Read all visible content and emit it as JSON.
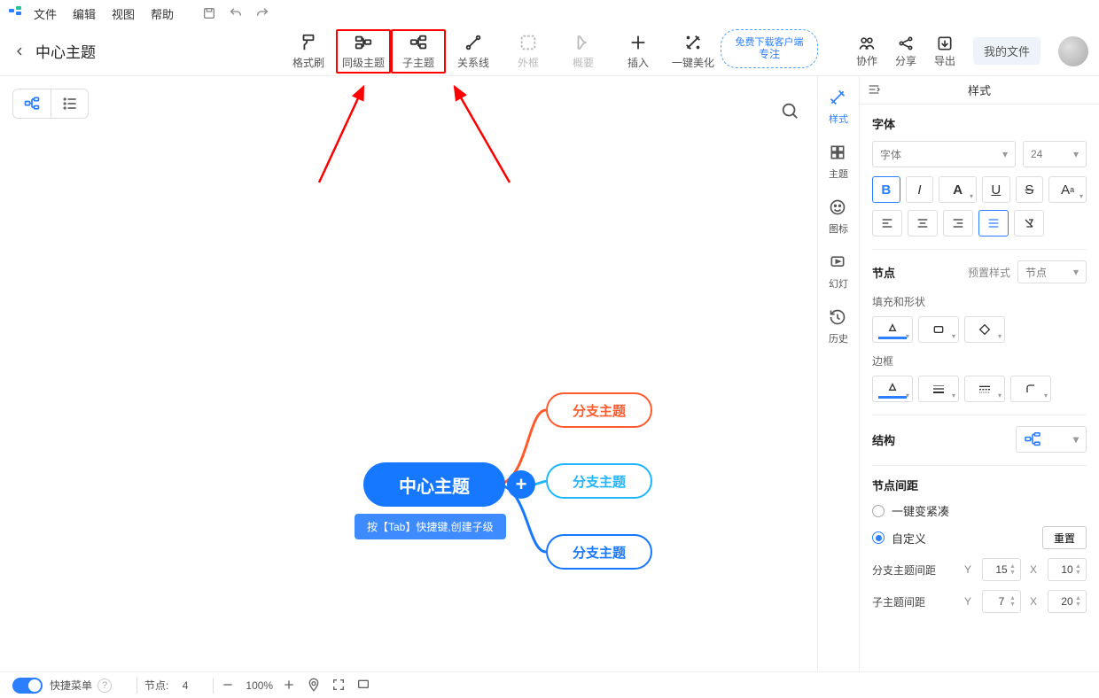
{
  "menubar": {
    "items": [
      "文件",
      "编辑",
      "视图",
      "帮助"
    ]
  },
  "header": {
    "title": "中心主题",
    "toolbar": {
      "format_painter": "格式刷",
      "same_level": "同级主题",
      "child_topic": "子主题",
      "relation": "关系线",
      "frame": "外框",
      "summary": "概要",
      "insert": "插入",
      "beautify": "一键美化",
      "promo_top": "免费下载客户端",
      "focus": "专注",
      "collab": "协作",
      "share": "分享",
      "export": "导出"
    },
    "my_files": "我的文件"
  },
  "sidenav": {
    "style": "样式",
    "theme": "主题",
    "icon": "图标",
    "slide": "幻灯",
    "history": "历史"
  },
  "panel": {
    "title": "样式",
    "font_section": "字体",
    "font_placeholder": "字体",
    "font_size": "24",
    "node_section": "节点",
    "preset": "预置样式",
    "preset_value": "节点",
    "fill_shape": "填充和形状",
    "border": "边框",
    "structure": "结构",
    "spacing_section": "节点间距",
    "compact_label": "一键变紧凑",
    "custom_label": "自定义",
    "reset": "重置",
    "branch_spacing": "分支主题间距",
    "child_spacing": "子主题间距",
    "branch_y": "15",
    "branch_x": "10",
    "child_y": "7",
    "child_x": "20"
  },
  "mindmap": {
    "center": "中心主题",
    "branch1": "分支主题",
    "branch2": "分支主题",
    "branch3": "分支主题",
    "tip": "按【Tab】快捷键,创建子级"
  },
  "statusbar": {
    "quick_menu": "快捷菜单",
    "nodes_label": "节点:",
    "nodes_count": "4",
    "zoom": "100%"
  }
}
